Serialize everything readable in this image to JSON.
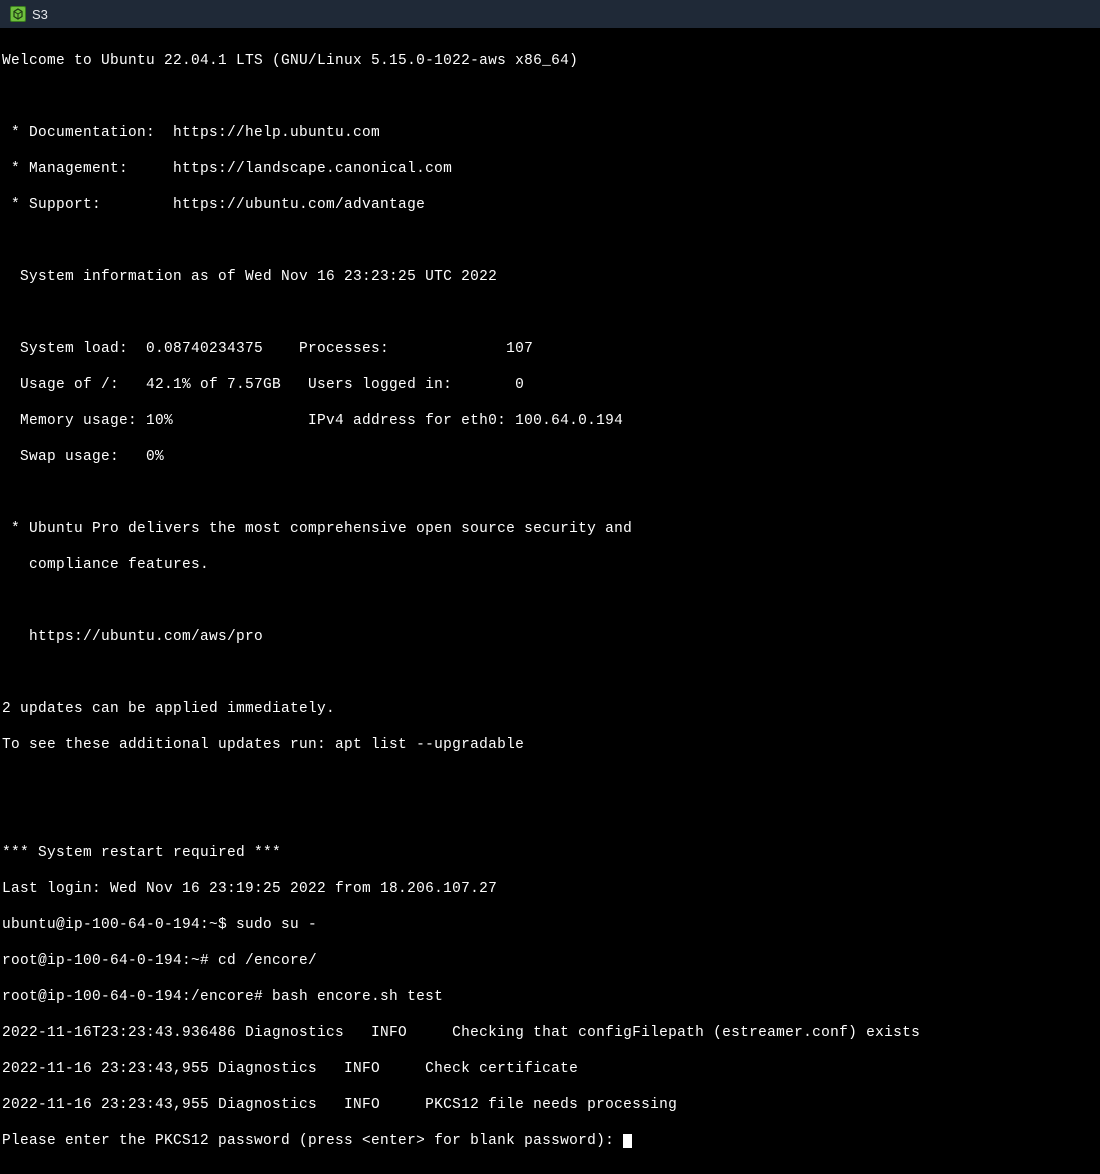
{
  "titlebar": {
    "tab_title": "S3",
    "icon_glyph": "◈"
  },
  "terminal": {
    "welcome": "Welcome to Ubuntu 22.04.1 LTS (GNU/Linux 5.15.0-1022-aws x86_64)",
    "blank": "",
    "doc_line": " * Documentation:  https://help.ubuntu.com",
    "mgmt_line": " * Management:     https://landscape.canonical.com",
    "support_line": " * Support:        https://ubuntu.com/advantage",
    "sysinfo_header": "  System information as of Wed Nov 16 23:23:25 UTC 2022",
    "sysload_line": "  System load:  0.08740234375    Processes:             107",
    "usage_line": "  Usage of /:   42.1% of 7.57GB   Users logged in:       0",
    "memory_line": "  Memory usage: 10%               IPv4 address for eth0: 100.64.0.194",
    "swap_line": "  Swap usage:   0%",
    "ubuntupro_1": " * Ubuntu Pro delivers the most comprehensive open source security and",
    "ubuntupro_2": "   compliance features.",
    "ubuntupro_url": "   https://ubuntu.com/aws/pro",
    "updates_1": "2 updates can be applied immediately.",
    "updates_2": "To see these additional updates run: apt list --upgradable",
    "restart_required": "*** System restart required ***",
    "last_login": "Last login: Wed Nov 16 23:19:25 2022 from 18.206.107.27",
    "prompt1": "ubuntu@ip-100-64-0-194:~$ sudo su -",
    "prompt2": "root@ip-100-64-0-194:~# cd /encore/",
    "prompt3": "root@ip-100-64-0-194:/encore# bash encore.sh test",
    "log1": "2022-11-16T23:23:43.936486 Diagnostics   INFO     Checking that configFilepath (estreamer.conf) exists",
    "log2": "2022-11-16 23:23:43,955 Diagnostics   INFO     Check certificate",
    "log3": "2022-11-16 23:23:43,955 Diagnostics   INFO     PKCS12 file needs processing",
    "password_prompt": "Please enter the PKCS12 password (press <enter> for blank password): "
  }
}
